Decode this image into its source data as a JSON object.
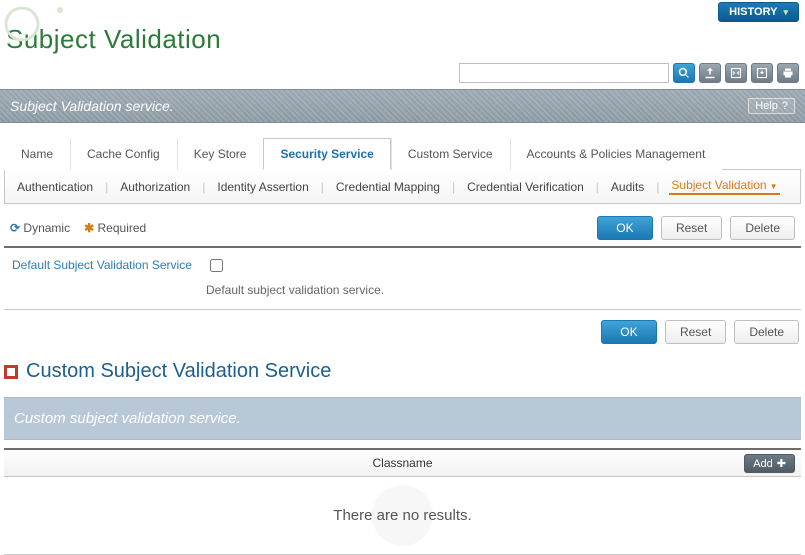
{
  "header": {
    "history_label": "HISTORY",
    "page_title": "Subject Validation"
  },
  "search": {
    "placeholder": "",
    "value": ""
  },
  "section_band": {
    "label": "Subject Validation service.",
    "help_label": "Help"
  },
  "tabs1": [
    {
      "label": "Name"
    },
    {
      "label": "Cache Config"
    },
    {
      "label": "Key Store"
    },
    {
      "label": "Security Service",
      "active": true
    },
    {
      "label": "Custom Service"
    },
    {
      "label": "Accounts & Policies Management"
    }
  ],
  "tabs2": [
    {
      "label": "Authentication"
    },
    {
      "label": "Authorization"
    },
    {
      "label": "Identity Assertion"
    },
    {
      "label": "Credential Mapping"
    },
    {
      "label": "Credential Verification"
    },
    {
      "label": "Audits"
    },
    {
      "label": "Subject Validation",
      "active": true,
      "dropdown": true
    }
  ],
  "legend": {
    "dynamic": "Dynamic",
    "required": "Required"
  },
  "actions": {
    "ok": "OK",
    "reset": "Reset",
    "delete": "Delete"
  },
  "form": {
    "default_service_label": "Default Subject Validation Service",
    "default_service_checked": false,
    "default_service_desc": "Default subject validation service."
  },
  "custom_section": {
    "title": "Custom Subject Validation Service",
    "band": "Custom subject validation service.",
    "col_classname": "Classname",
    "add_label": "Add",
    "empty": "There are no results."
  }
}
